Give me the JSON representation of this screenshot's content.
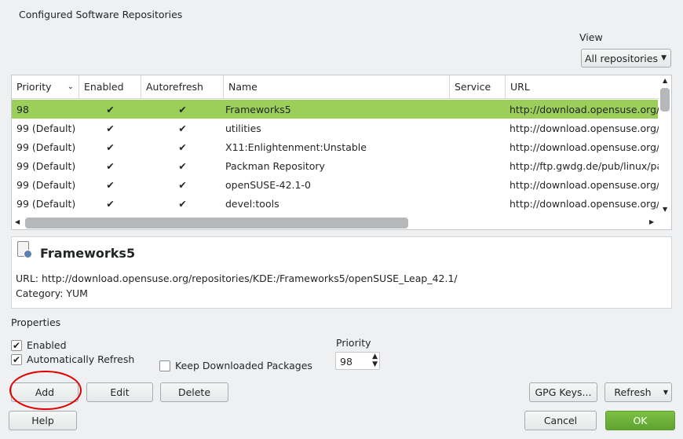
{
  "title": "Configured Software Repositories",
  "view": {
    "label": "View",
    "selected": "All repositories"
  },
  "columns": [
    "Priority",
    "Enabled",
    "Autorefresh",
    "Name",
    "Service",
    "URL"
  ],
  "rows": [
    {
      "priority": "98",
      "enabled": "✔",
      "autorefresh": "✔",
      "name": "Frameworks5",
      "service": "",
      "url": "http://download.opensuse.org/",
      "selected": true
    },
    {
      "priority": "99 (Default)",
      "enabled": "✔",
      "autorefresh": "✔",
      "name": "utilities",
      "service": "",
      "url": "http://download.opensuse.org/"
    },
    {
      "priority": "99 (Default)",
      "enabled": "✔",
      "autorefresh": "✔",
      "name": "X11:Enlightenment:Unstable",
      "service": "",
      "url": "http://download.opensuse.org/"
    },
    {
      "priority": "99 (Default)",
      "enabled": "✔",
      "autorefresh": "✔",
      "name": "Packman Repository",
      "service": "",
      "url": "http://ftp.gwdg.de/pub/linux/pa"
    },
    {
      "priority": "99 (Default)",
      "enabled": "✔",
      "autorefresh": "✔",
      "name": "openSUSE-42.1-0",
      "service": "",
      "url": "http://download.opensuse.org/"
    },
    {
      "priority": "99 (Default)",
      "enabled": "✔",
      "autorefresh": "✔",
      "name": "devel:tools",
      "service": "",
      "url": "http://download.opensuse.org/"
    }
  ],
  "detail": {
    "name": "Frameworks5",
    "url": "URL: http://download.opensuse.org/repositories/KDE:/Frameworks5/openSUSE_Leap_42.1/",
    "category": "Category: YUM"
  },
  "properties": {
    "label": "Properties",
    "enabled": "Enabled",
    "auto_refresh": "Automatically Refresh",
    "keep_packages": "Keep Downloaded Packages",
    "priority_label": "Priority",
    "priority_value": "98"
  },
  "buttons": {
    "add": "Add",
    "edit": "Edit",
    "delete": "Delete",
    "gpg": "GPG Keys...",
    "refresh": "Refresh",
    "help": "Help",
    "cancel": "Cancel",
    "ok": "OK"
  },
  "colors": {
    "selection": "#9ccf5a",
    "ok": "#6cae3a",
    "annotation": "#e00000"
  }
}
